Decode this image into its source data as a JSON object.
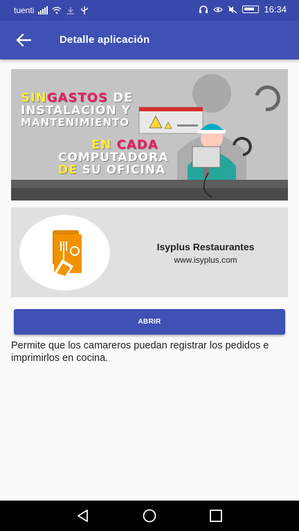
{
  "status_bar": {
    "carrier": "tuenti",
    "time": "16:34",
    "icons": [
      "signal-icon",
      "wifi-icon",
      "download-icon",
      "usb-icon",
      "headphones-icon",
      "eye-icon",
      "mute-icon",
      "battery-icon"
    ]
  },
  "app_bar": {
    "title": "Detalle aplicación",
    "back_icon": "arrow-left-icon"
  },
  "banner": {
    "line1_part1": "SIN",
    "line1_part2": "GASTOS",
    "line1_part3": " DE",
    "line2": "INSTALACIÓN Y",
    "line3": "MANTENIMIENTO",
    "line4_part1": "EN",
    "line4_part2": " CADA",
    "line5": "COMPUTADORA",
    "line6_part1": "DE",
    "line6_part2": " SU OFICINA",
    "colors": {
      "magenta": "#e91e63",
      "yellow": "#ffeb3b",
      "white": "#ffffff",
      "background": "#bdbdbd"
    }
  },
  "app_card": {
    "name": "Isyplus Restaurantes",
    "url": "www.isyplus.com",
    "logo_icon": "restaurant-menu-icon",
    "logo_color": "#f39200"
  },
  "open_button": {
    "label": "ABRIR"
  },
  "description": "Permite que los camareros puedan registrar los pedidos e imprimirlos en cocina.",
  "nav_bar": {
    "icons": [
      "back-triangle-icon",
      "home-circle-icon",
      "recents-square-icon"
    ]
  },
  "colors": {
    "primary": "#3f51b5",
    "status": "#3949ab",
    "card": "#e0e0e0"
  }
}
